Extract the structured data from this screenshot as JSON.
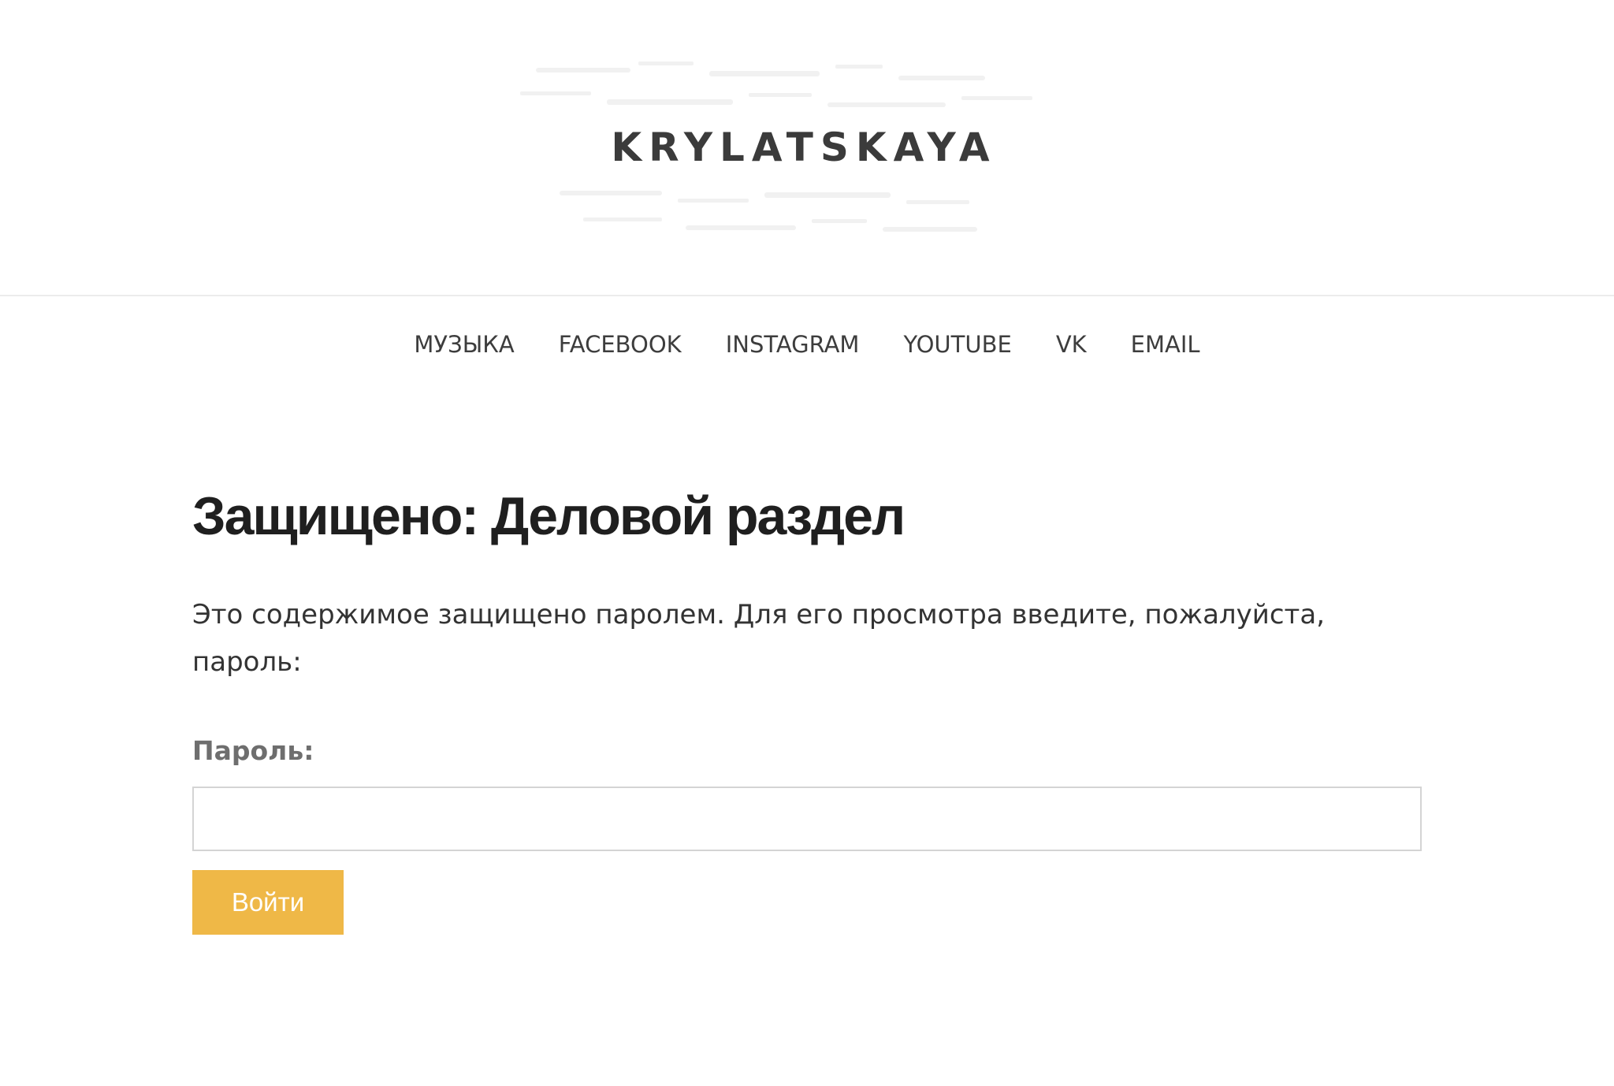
{
  "brand": {
    "logo_text": "KRYLATSKAYA"
  },
  "nav": {
    "items": [
      {
        "label": "МУЗЫКА"
      },
      {
        "label": "FACEBOOK"
      },
      {
        "label": "INSTAGRAM"
      },
      {
        "label": "YOUTUBE"
      },
      {
        "label": "VK"
      },
      {
        "label": "EMAIL"
      }
    ]
  },
  "page": {
    "title": "Защищено: Деловой раздел",
    "prompt": "Это содержимое защищено паролем. Для его просмотра введите, пожалуйста, пароль:",
    "password_label": "Пароль:",
    "password_value": "",
    "submit_label": "Войти"
  },
  "colors": {
    "accent_button": "#efb847",
    "title_text": "#1f1f1f",
    "label_text": "#6e6e6e"
  }
}
